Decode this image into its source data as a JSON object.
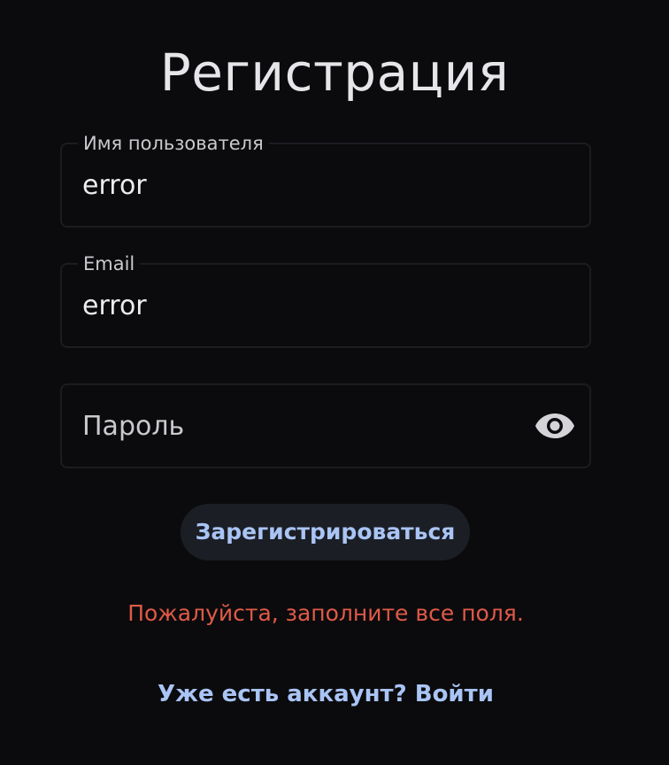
{
  "page": {
    "title": "Регистрация"
  },
  "form": {
    "username": {
      "label": "Имя пользователя",
      "value": "error"
    },
    "email": {
      "label": "Email",
      "value": "error"
    },
    "password": {
      "placeholder": "Пароль",
      "visibility_icon": "eye-icon"
    },
    "submit_label": "Зарегистрироваться"
  },
  "error_message": "Пожалуйста, заполните все поля.",
  "login_link": "Уже есть аккаунт? Войти",
  "colors": {
    "background": "#0b0b0d",
    "accent": "#a9c4f5",
    "error": "#e05a48"
  }
}
